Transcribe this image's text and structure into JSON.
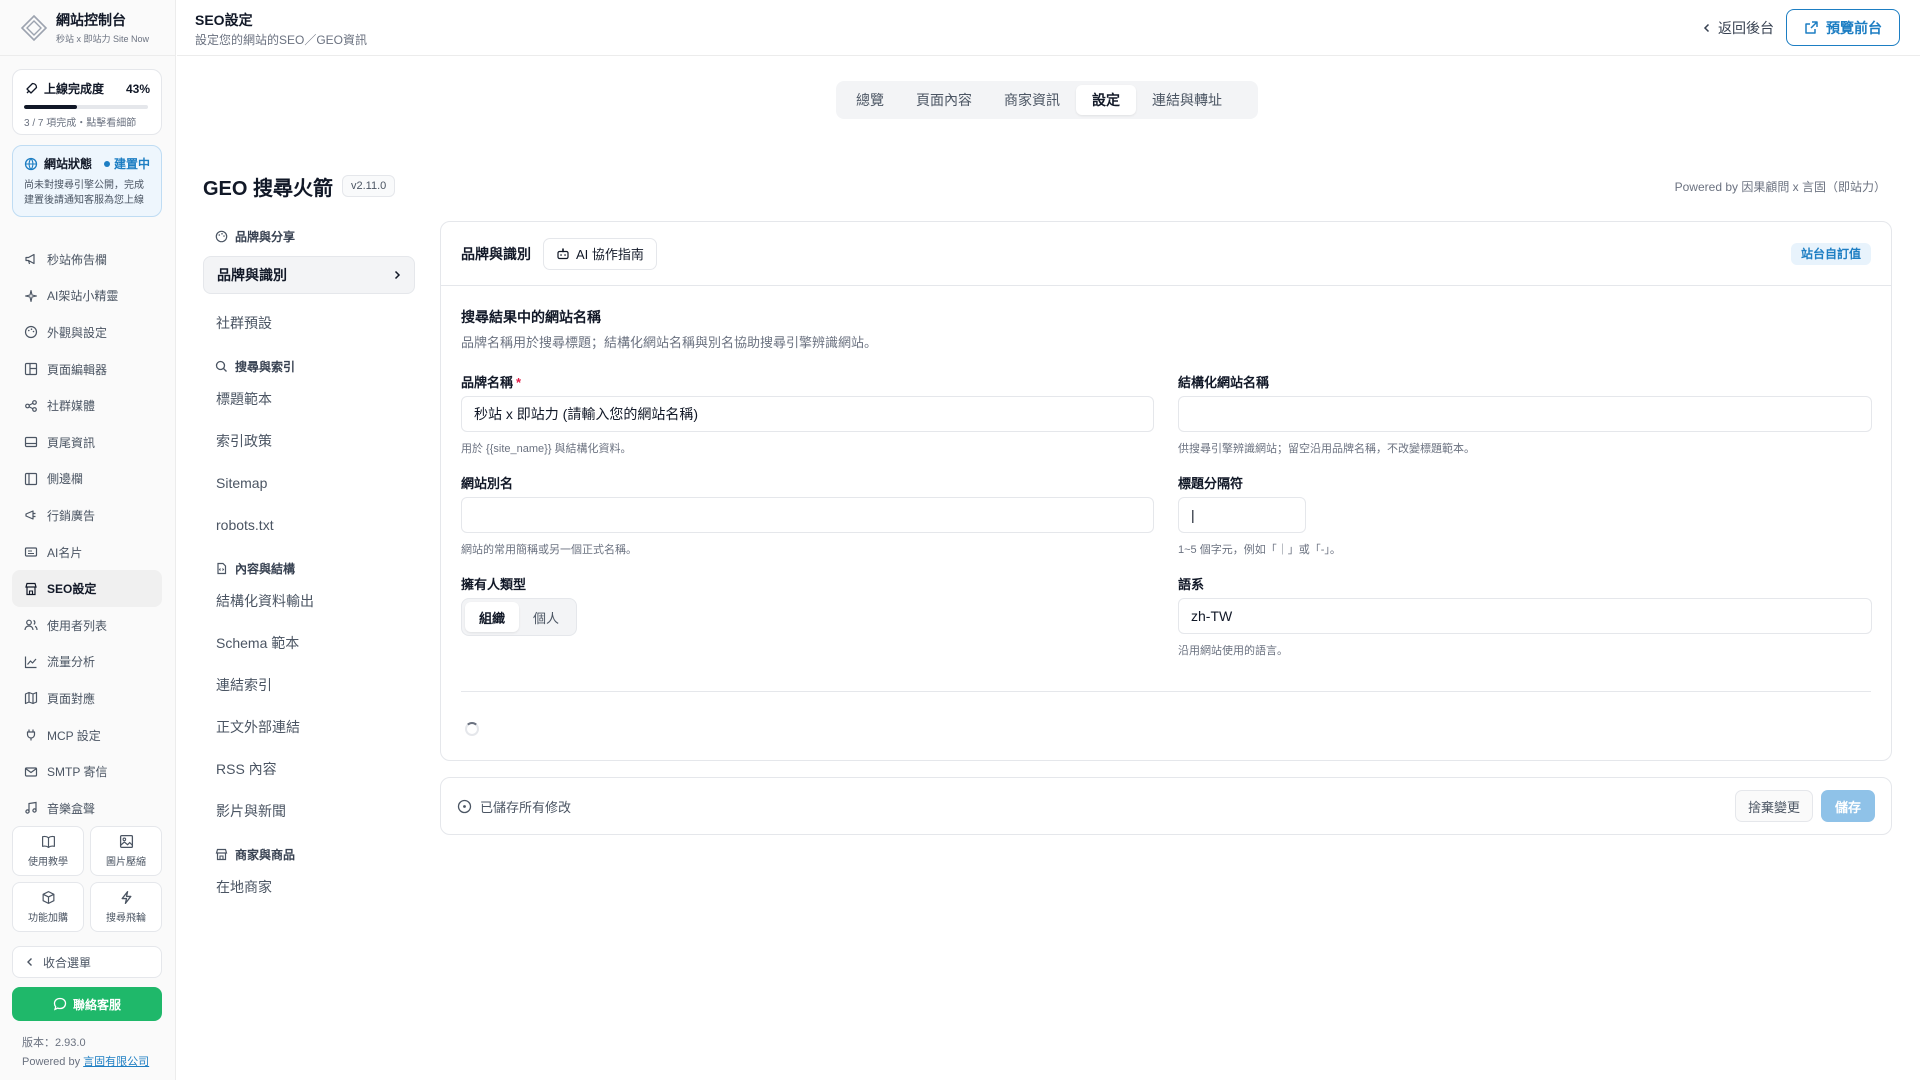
{
  "brand": {
    "title": "網站控制台",
    "subtitle": "秒站 x 即站力 Site Now"
  },
  "progress": {
    "title": "上線完成度",
    "percent_label": "43%",
    "fraction": 0.43,
    "note": "3 / 7 項完成・點擊看細節"
  },
  "site_status": {
    "title": "網站狀態",
    "badge": "建置中",
    "text": "尚未對搜尋引擎公開，完成建置後請通知客服為您上線"
  },
  "nav": [
    {
      "label": "秒站佈告欄",
      "icon": "megaphone-icon"
    },
    {
      "label": "AI架站小精靈",
      "icon": "sparkle-icon"
    },
    {
      "label": "外觀與設定",
      "icon": "palette-icon"
    },
    {
      "label": "頁面編輯器",
      "icon": "layout-icon"
    },
    {
      "label": "社群媒體",
      "icon": "share-icon"
    },
    {
      "label": "頁尾資訊",
      "icon": "footer-icon"
    },
    {
      "label": "側邊欄",
      "icon": "sidebar-icon"
    },
    {
      "label": "行銷廣告",
      "icon": "ad-icon"
    },
    {
      "label": "AI名片",
      "icon": "card-icon"
    },
    {
      "label": "SEO設定",
      "icon": "seo-icon",
      "active": true
    },
    {
      "label": "使用者列表",
      "icon": "users-icon"
    },
    {
      "label": "流量分析",
      "icon": "chart-icon"
    },
    {
      "label": "頁面對應",
      "icon": "map-icon"
    },
    {
      "label": "MCP 設定",
      "icon": "plug-icon"
    },
    {
      "label": "SMTP 寄信",
      "icon": "mail-icon"
    },
    {
      "label": "音樂盒聲",
      "icon": "music-icon"
    }
  ],
  "tiles": [
    {
      "label": "使用教學",
      "icon": "book-icon"
    },
    {
      "label": "圖片壓縮",
      "icon": "image-icon"
    },
    {
      "label": "功能加購",
      "icon": "box-icon"
    },
    {
      "label": "搜尋飛輪",
      "icon": "bolt-icon"
    }
  ],
  "collapse_label": "收合選單",
  "contact_label": "聯絡客服",
  "version_label": "版本：2.93.0",
  "powered_side": {
    "prefix": "Powered by ",
    "link": "言固有限公司"
  },
  "header": {
    "title": "SEO設定",
    "subtitle": "設定您的網站的SEO／GEO資訊",
    "back_label": "返回後台",
    "preview_label": "預覽前台"
  },
  "top_tabs": [
    {
      "label": "總覽"
    },
    {
      "label": "頁面內容"
    },
    {
      "label": "商家資訊"
    },
    {
      "label": "設定",
      "active": true
    },
    {
      "label": "連結與轉址"
    }
  ],
  "geo": {
    "title": "GEO 搜尋火箭",
    "version": "v2.11.0",
    "powered": "Powered by 因果顧問 x 言固（即站力）"
  },
  "subnav": {
    "brand_group": "品牌與分享",
    "brand_items": [
      "品牌與識別",
      "社群預設"
    ],
    "search_group": "搜尋與索引",
    "search_items": [
      "標題範本",
      "索引政策",
      "Sitemap",
      "robots.txt"
    ],
    "content_group": "內容與結構",
    "content_items": [
      "結構化資料輸出",
      "Schema 範本",
      "連結索引",
      "正文外部連結",
      "RSS 內容",
      "影片與新聞"
    ],
    "merchant_group": "商家與商品",
    "merchant_items": [
      "在地商家"
    ]
  },
  "card": {
    "title": "品牌與識別",
    "ai_guide_label": "AI 協作指南",
    "custom_badge": "站台自訂值",
    "section_title": "搜尋結果中的網站名稱",
    "section_desc": "品牌名稱用於搜尋標題；結構化網站名稱與別名協助搜尋引擎辨識網站。",
    "brand_name": {
      "label": "品牌名稱",
      "value": "秒站 x 即站力 (請輸入您的網站名稱)",
      "hint": "用於 {{site_name}} 與結構化資料。"
    },
    "structured_name": {
      "label": "結構化網站名稱",
      "value": "",
      "hint": "供搜尋引擎辨識網站；留空沿用品牌名稱，不改變標題範本。"
    },
    "alias": {
      "label": "網站別名",
      "value": "",
      "hint": "網站的常用簡稱或另一個正式名稱。"
    },
    "separator": {
      "label": "標題分隔符",
      "value": "|",
      "hint": "1~5 個字元，例如「｜」或「-」。"
    },
    "owner_type": {
      "label": "擁有人類型",
      "options": [
        "組織",
        "個人"
      ],
      "selected": "組織"
    },
    "language": {
      "label": "語系",
      "value": "zh-TW",
      "hint": "沿用網站使用的語言。"
    }
  },
  "savebar": {
    "status": "已儲存所有修改",
    "discard_label": "捨棄變更",
    "save_label": "儲存"
  },
  "colors": {
    "accent": "#1d7ec3",
    "success": "#1fb86a",
    "save_disabled": "#8fc2e8"
  }
}
